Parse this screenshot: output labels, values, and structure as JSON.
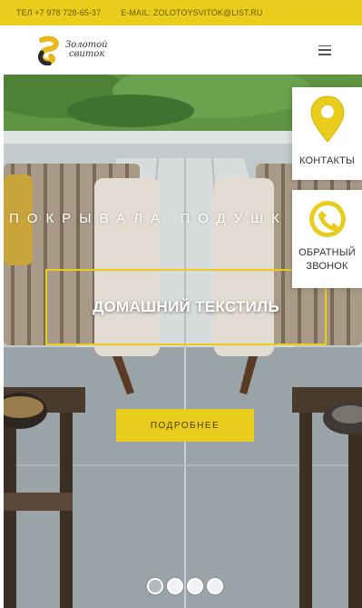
{
  "topbar": {
    "phone": "ТЕЛ +7 978 728-65-37",
    "email": "E-MAIL: ZOLOTOYSVITOK@LIST.RU"
  },
  "header": {
    "logo_line1": "Золотой",
    "logo_line2": "свиток"
  },
  "hero": {
    "subtitle": "ПОКРЫВАЛА ПОДУШК",
    "title": "ДОМАШНИЙ ТЕКСТИЛЬ",
    "button": "ПОДРОБНЕЕ",
    "slides": 4,
    "active_slide": 1
  },
  "side": {
    "contacts_label": "КОНТАКТЫ",
    "callback_label_1": "ОБРАТНЫЙ",
    "callback_label_2": "ЗВОНОК"
  },
  "colors": {
    "accent": "#e9cd1d"
  }
}
